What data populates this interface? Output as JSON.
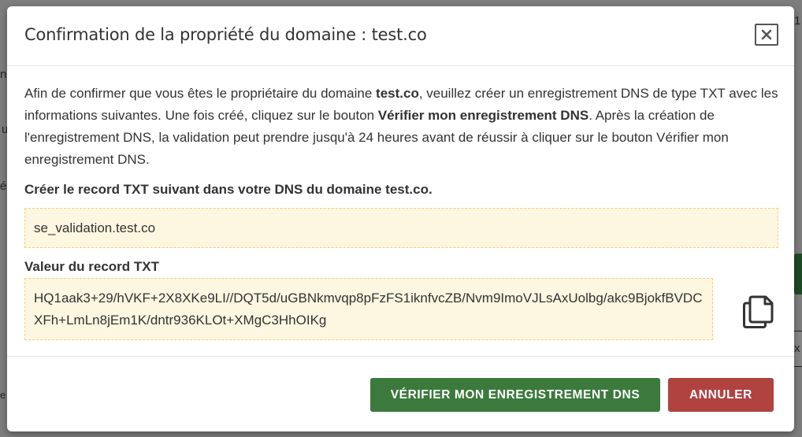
{
  "background": {
    "fragments": [
      "n",
      "1",
      "u",
      "é",
      "x",
      "e"
    ]
  },
  "modal": {
    "title": "Confirmation de la propriété du domaine : test.co",
    "close_icon": "close-icon",
    "intro": {
      "p1": "Afin de confirmer que vous êtes le propriétaire du domaine ",
      "domain": "test.co",
      "p2": ", veuillez créer un enregistrement DNS de type TXT avec les informations suivantes. Une fois créé, cliquez sur le bouton ",
      "button_ref": "Vérifier mon enregistrement DNS",
      "p3": ". Après la création de l'enregistrement DNS, la validation peut prendre jusqu'à 24 heures avant de réussir à cliquer sur le bouton Vérifier mon enregistrement DNS."
    },
    "record_label": "Créer le record TXT suivant dans votre DNS du domaine test.co.",
    "record_name": "se_validation.test.co",
    "value_label": "Valeur du record TXT",
    "record_value": "HQ1aak3+29/hVKF+2X8XKe9LI//DQT5d/uGBNkmvqp8pFzFS1iknfvcZB/Nvm9ImoVJLsAxUolbg/akc9BjokfBVDCXFh+LmLn8jEm1K/dntr936KLOt+XMgC3HhOIKg",
    "copy_icon": "copy-icon",
    "buttons": {
      "verify": "VÉRIFIER MON ENREGISTREMENT DNS",
      "cancel": "ANNULER"
    }
  },
  "colors": {
    "verify": "#3b7a3c",
    "cancel": "#b04240",
    "highlight_bg": "#fdf6e0",
    "highlight_border": "#f0d27a"
  }
}
